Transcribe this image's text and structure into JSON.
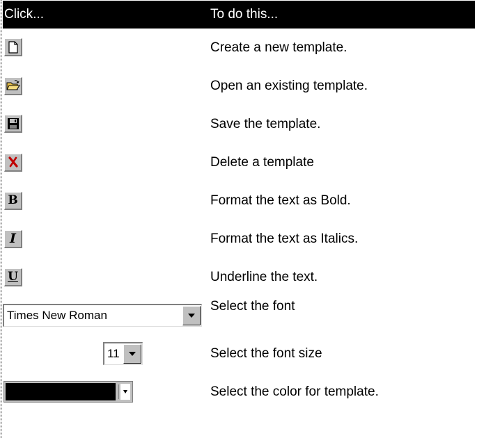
{
  "header": {
    "col_click": "Click...",
    "col_action": "To do this..."
  },
  "rows": [
    {
      "icon": "new-document-icon",
      "description": "Create a new template."
    },
    {
      "icon": "open-folder-icon",
      "description": "Open an existing template."
    },
    {
      "icon": "save-disk-icon",
      "description": "Save the template."
    },
    {
      "icon": "delete-x-icon",
      "description": "Delete a template"
    },
    {
      "icon": "bold-icon",
      "glyph": "B",
      "description": "Format the text as Bold."
    },
    {
      "icon": "italic-icon",
      "glyph": "I",
      "description": "Format the text as Italics."
    },
    {
      "icon": "underline-icon",
      "glyph": "U",
      "description": "Underline the text."
    },
    {
      "control": "font-select",
      "value": "Times New Roman",
      "description": "Select the font"
    },
    {
      "control": "font-size-select",
      "value": "11",
      "description": "Select the font size"
    },
    {
      "control": "color-select",
      "value_color": "#000000",
      "description": "Select the color for template."
    }
  ],
  "colors": {
    "header_bg": "#000000",
    "header_text": "#ffffff",
    "button_face": "#c0c0c0",
    "delete_red": "#c00000",
    "folder_yellow": "#e8c04a"
  }
}
